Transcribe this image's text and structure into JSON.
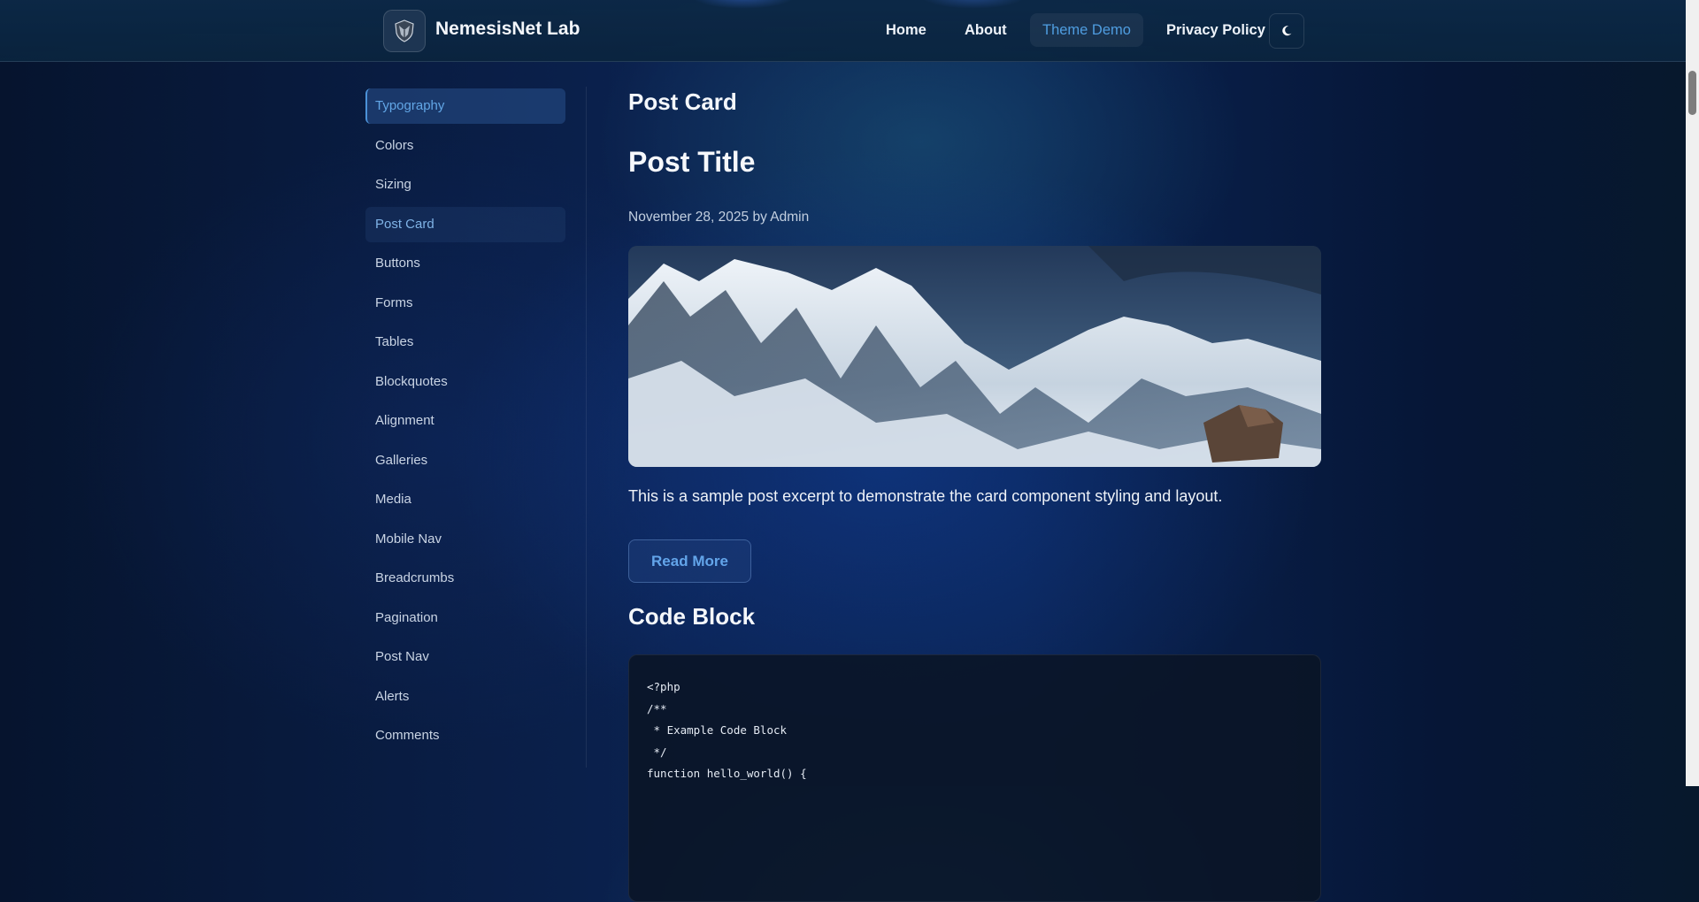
{
  "header": {
    "site_title": "NemesisNet Lab",
    "nav": [
      {
        "label": "Home"
      },
      {
        "label": "About"
      },
      {
        "label": "Theme Demo",
        "active": true
      },
      {
        "label": "Privacy Policy"
      }
    ],
    "theme_toggle_icon": "moon-icon",
    "logo_icon": "shield-logo-icon"
  },
  "sidebar": {
    "items": [
      {
        "label": "Typography",
        "state": "active"
      },
      {
        "label": "Colors"
      },
      {
        "label": "Sizing"
      },
      {
        "label": "Post Card",
        "state": "hover"
      },
      {
        "label": "Buttons"
      },
      {
        "label": "Forms"
      },
      {
        "label": "Tables"
      },
      {
        "label": "Blockquotes"
      },
      {
        "label": "Alignment"
      },
      {
        "label": "Galleries"
      },
      {
        "label": "Media"
      },
      {
        "label": "Mobile Nav"
      },
      {
        "label": "Breadcrumbs"
      },
      {
        "label": "Pagination"
      },
      {
        "label": "Post Nav"
      },
      {
        "label": "Alerts"
      },
      {
        "label": "Comments"
      }
    ]
  },
  "main": {
    "section_title": "Post Card",
    "post": {
      "title": "Post Title",
      "meta": "November 28, 2025 by Admin",
      "excerpt": "This is a sample post excerpt to demonstrate the card component styling and layout.",
      "button_label": "Read More"
    },
    "code_section_title": "Code Block",
    "code_lines": [
      "<?php",
      "/**",
      " * Example Code Block",
      " */",
      "function hello_world() {"
    ]
  },
  "colors": {
    "accent": "#4f9de0",
    "background": "#0a2352"
  }
}
